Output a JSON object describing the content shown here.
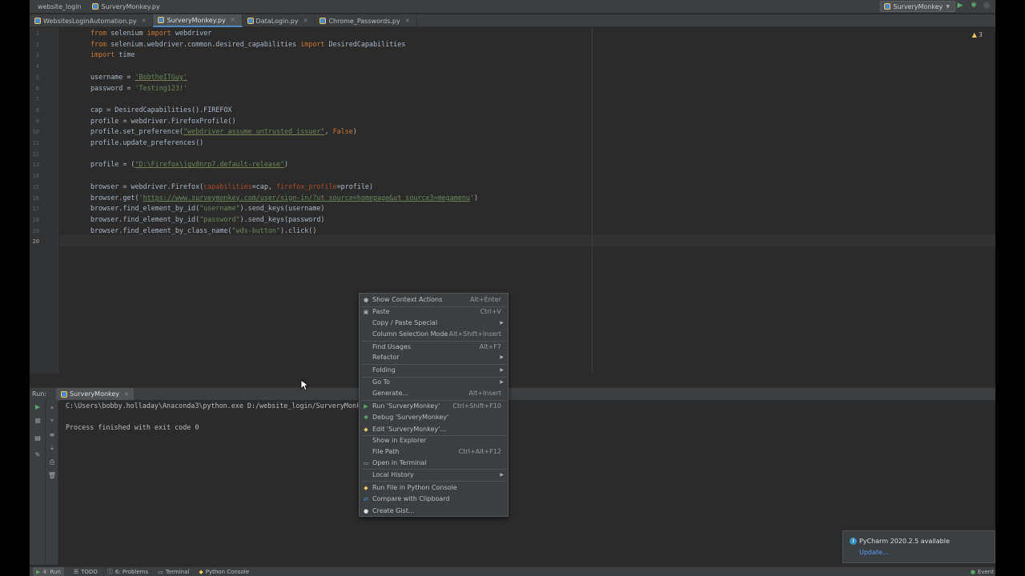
{
  "nav": {
    "project": "website_login",
    "file": "SurveryMonkey.py",
    "run_config": "SurveryMonkey"
  },
  "tabs": [
    {
      "label": "WebsitesLoginAutomation.py"
    },
    {
      "label": "SurveryMonkey.py"
    },
    {
      "label": "DataLogin.py"
    },
    {
      "label": "Chrome_Passwords.py"
    }
  ],
  "editor": {
    "line_numbers": [
      "1",
      "2",
      "3",
      "4",
      "5",
      "6",
      "7",
      "8",
      "9",
      "10",
      "11",
      "12",
      "13",
      "14",
      "15",
      "16",
      "17",
      "18",
      "19",
      "20"
    ],
    "warnings": "3",
    "code": {
      "l1": {
        "kw1": "from",
        "t1": " selenium ",
        "kw2": "import",
        "t2": " webdriver"
      },
      "l2": {
        "kw1": "from",
        "t1": " selenium.webdriver.common.desired_capabilities ",
        "kw2": "import",
        "t2": " DesiredCapabilities"
      },
      "l3": {
        "kw1": "import",
        "t1": " time"
      },
      "l5": {
        "t1": "username = ",
        "s1": "'BobtheITGuy'"
      },
      "l6": {
        "t1": "password = ",
        "s1": "'Testing123!'"
      },
      "l8": {
        "t1": "cap = DesiredCapabilities().FIREFOX"
      },
      "l9": {
        "t1": "profile = webdriver.FirefoxProfile()"
      },
      "l10": {
        "t1": "profile.set_preference(",
        "s1": "\"webdriver_assume_untrusted_issuer\"",
        "t2": ", ",
        "kw1": "False",
        "t3": ")"
      },
      "l11": {
        "t1": "profile.update_preferences()"
      },
      "l13": {
        "t1": "profile = ",
        "t2": "(",
        "s1": "\"D:\\Firefox\\jqy8nrp7.default-release\"",
        "t3": ")"
      },
      "l15": {
        "t1": "browser = webdriver.Firefox(",
        "p1": "capabilities",
        "t2": "=cap, ",
        "p2": "firefox_profile",
        "t3": "=profile)"
      },
      "l16": {
        "t1": "browser.get(",
        "s1": "'",
        "lnk": "https://www.surveymonkey.com/user/sign-in/?ut_source=homepage&ut_source3=megamenu",
        "s2": "'",
        "t2": ")"
      },
      "l17": {
        "t1": "browser.find_element_by_id(",
        "s1": "\"username\"",
        "t2": ").send_keys(username)"
      },
      "l18": {
        "t1": "browser.find_element_by_id(",
        "s1": "\"password\"",
        "t2": ").send_keys(password)"
      },
      "l19": {
        "t1": "browser.find_element_by_class_name(",
        "s1": "\"wds-button\"",
        "t2": ").click()"
      }
    }
  },
  "context_menu": [
    {
      "label": "Show Context Actions",
      "shortcut": "Alt+Enter",
      "icon": "bulb-icon"
    },
    {
      "label": "Paste",
      "shortcut": "Ctrl+V",
      "icon": "clipboard-icon"
    },
    {
      "label": "Copy / Paste Special",
      "submenu": true
    },
    {
      "label": "Column Selection Mode",
      "shortcut": "Alt+Shift+Insert"
    },
    {
      "label": "Find Usages",
      "shortcut": "Alt+F7"
    },
    {
      "label": "Refactor",
      "submenu": true
    },
    {
      "label": "Folding",
      "submenu": true
    },
    {
      "label": "Go To",
      "submenu": true
    },
    {
      "label": "Generate...",
      "shortcut": "Alt+Insert"
    },
    {
      "label": "Run 'SurveryMonkey'",
      "shortcut": "Ctrl+Shift+F10",
      "icon": "run-icon"
    },
    {
      "label": "Debug 'SurveryMonkey'",
      "icon": "debug-icon"
    },
    {
      "label": "Edit 'SurveryMonkey'...",
      "icon": "python-icon"
    },
    {
      "label": "Show in Explorer"
    },
    {
      "label": "File Path",
      "shortcut": "Ctrl+Alt+F12"
    },
    {
      "label": "Open in Terminal",
      "icon": "terminal-icon"
    },
    {
      "label": "Local History",
      "submenu": true
    },
    {
      "label": "Run File in Python Console",
      "icon": "python-icon"
    },
    {
      "label": "Compare with Clipboard",
      "icon": "compare-icon"
    },
    {
      "label": "Create Gist...",
      "icon": "github-icon"
    }
  ],
  "run_panel": {
    "label": "Run:",
    "tab": "SurveryMonkey",
    "console": [
      "C:\\Users\\bobby.holladay\\Anaconda3\\python.exe D:/website_login/SurveryMonkey.py",
      "",
      "Process finished with exit code 0"
    ]
  },
  "bottom_bar": {
    "run": "4: Run",
    "todo": "TODO",
    "problems": "6: Problems",
    "terminal": "Terminal",
    "python_console": "Python Console",
    "event_log": "Event"
  },
  "notification": {
    "title": "PyCharm 2020.2.5 available",
    "link": "Update..."
  },
  "colors": {
    "bg": "#2b2b2b",
    "panel": "#3c3f41",
    "keyword": "#cc7832",
    "string": "#6a8759",
    "param": "#aa4926",
    "accent": "#4a88c7"
  }
}
